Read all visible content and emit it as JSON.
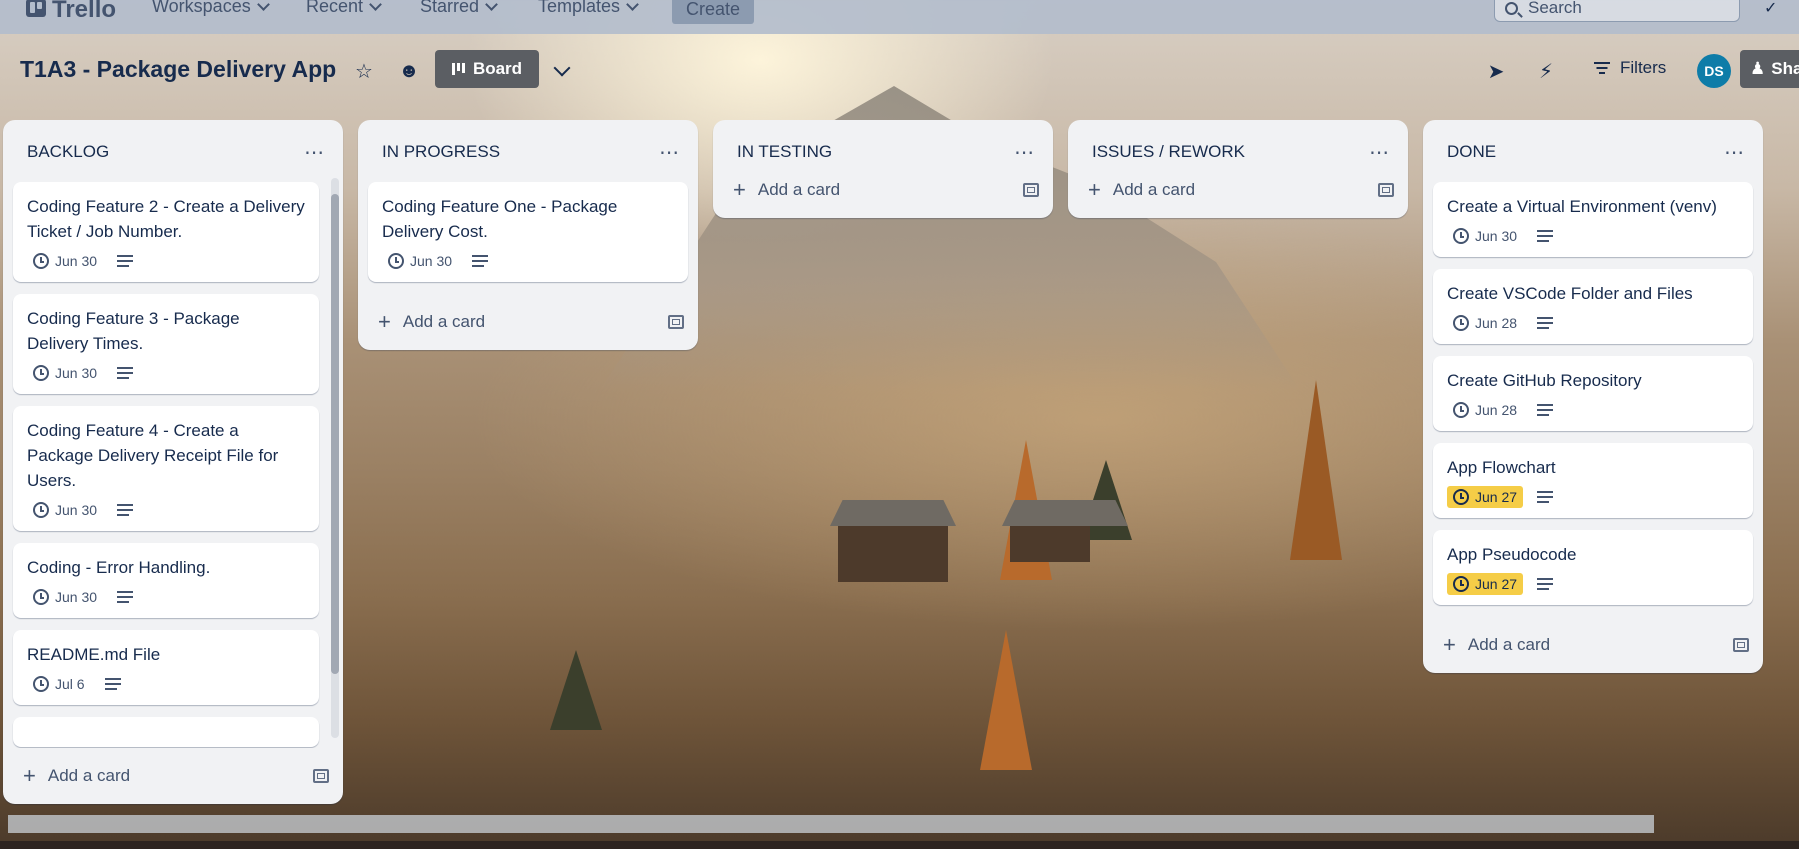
{
  "nav": {
    "logo_text": "Trello",
    "items": [
      {
        "label": "Workspaces"
      },
      {
        "label": "Recent"
      },
      {
        "label": "Starred"
      },
      {
        "label": "Templates"
      }
    ],
    "create_label": "Create",
    "search_placeholder": "Search"
  },
  "board": {
    "title": "T1A3 - Package Delivery App",
    "view_label": "Board",
    "filters_label": "Filters",
    "avatar_initials": "DS",
    "share_label": "Sha"
  },
  "lists": [
    {
      "title": "BACKLOG",
      "cards": [
        {
          "title": "Coding Feature 2 - Create a Delivery Ticket / Job Number.",
          "due": "Jun 30"
        },
        {
          "title": "Coding Feature 3 - Package Delivery Times.",
          "due": "Jun 30"
        },
        {
          "title": "Coding Feature 4 - Create a Package Delivery Receipt File for Users.",
          "due": "Jun 30"
        },
        {
          "title": "Coding - Error Handling.",
          "due": "Jun 30"
        },
        {
          "title": "README.md File",
          "due": "Jul 6"
        }
      ],
      "add_label": "Add a card"
    },
    {
      "title": "IN PROGRESS",
      "cards": [
        {
          "title": "Coding Feature One - Package Delivery Cost.",
          "due": "Jun 30"
        }
      ],
      "add_label": "Add a card"
    },
    {
      "title": "IN TESTING",
      "cards": [],
      "add_label": "Add a card"
    },
    {
      "title": "ISSUES / REWORK",
      "cards": [],
      "add_label": "Add a card"
    },
    {
      "title": "DONE",
      "cards": [
        {
          "title": "Create a Virtual Environment (venv)",
          "due": "Jun 30"
        },
        {
          "title": "Create VSCode Folder and Files",
          "due": "Jun 28"
        },
        {
          "title": "Create GitHub Repository",
          "due": "Jun 28"
        },
        {
          "title": "App Flowchart",
          "due": "Jun 27",
          "due_soon": true
        },
        {
          "title": "App Pseudocode",
          "due": "Jun 27",
          "due_soon": true
        }
      ],
      "add_label": "Add a card"
    }
  ],
  "colors": {
    "due_soon": "#f5cd47",
    "board_button": "#5b5e63",
    "avatar": "#0e7ca8"
  }
}
